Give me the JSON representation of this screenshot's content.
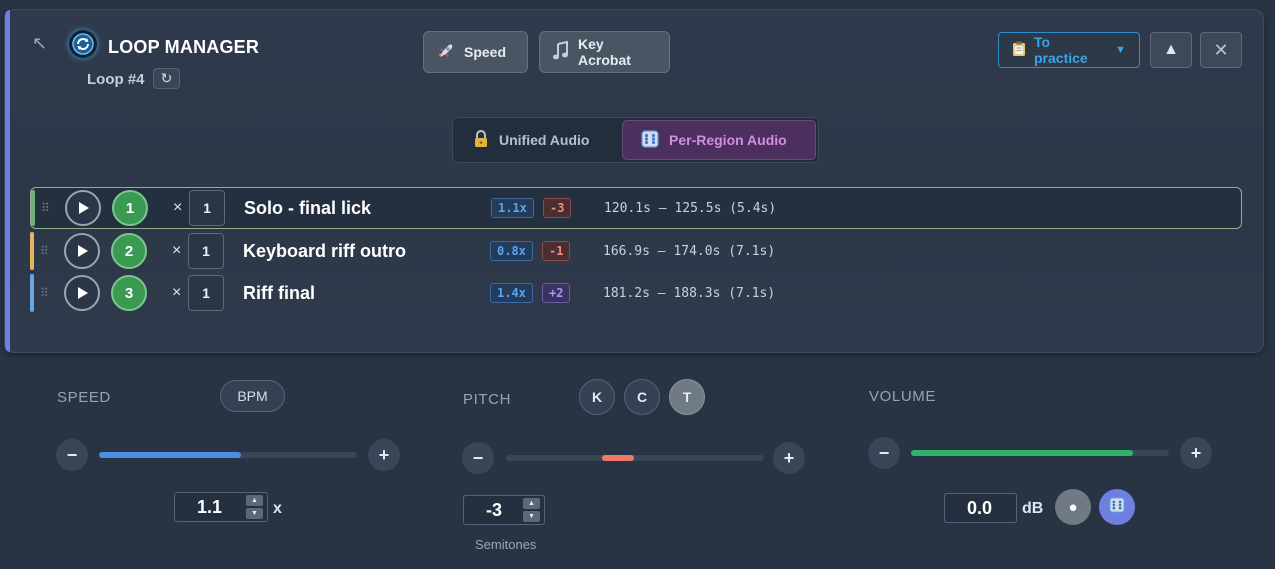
{
  "header": {
    "title": "LOOP MANAGER",
    "loop_number": "Loop #4",
    "refresh_symbol": "↻",
    "collapse_symbol": "↖",
    "speed_button": "Speed",
    "key_acrobat_button": "Key Acrobat",
    "practice_button": "To practice",
    "practice_caret": "▼",
    "up_symbol": "▲",
    "close_symbol": "✕"
  },
  "audio_mode": {
    "unified": "Unified Audio",
    "per_region": "Per-Region Audio",
    "selected": "per_region"
  },
  "loops": [
    {
      "index": "1",
      "times_symbol": "×",
      "repeat": "1",
      "name": "Solo - final lick",
      "speed": "1.1x",
      "pitch": "-3",
      "range": "120.1s – 125.5s (5.4s)",
      "stripe": "#6fb07a",
      "active": true
    },
    {
      "index": "2",
      "times_symbol": "×",
      "repeat": "1",
      "name": "Keyboard riff outro",
      "speed": "0.8x",
      "pitch": "-1",
      "range": "166.9s – 174.0s (7.1s)",
      "stripe": "#e8b25a",
      "active": false
    },
    {
      "index": "3",
      "times_symbol": "×",
      "repeat": "1",
      "name": "Riff final",
      "speed": "1.4x",
      "pitch": "+2",
      "range": "181.2s – 188.3s (7.1s)",
      "stripe": "#6aa6e0",
      "active": false
    }
  ],
  "speed": {
    "label": "SPEED",
    "bpm_button": "BPM",
    "value": "1.1",
    "unit": "x",
    "level": 0.55,
    "minus": "−",
    "plus": "+"
  },
  "pitch": {
    "label": "PITCH",
    "keys": [
      "K",
      "C",
      "T"
    ],
    "selected_key": "T",
    "value": "-3",
    "caption": "Semitones",
    "minus": "−",
    "plus": "+"
  },
  "volume": {
    "label": "VOLUME",
    "value": "0.0",
    "unit": "dB",
    "level": 0.86,
    "minus": "−",
    "plus": "+",
    "dot_symbol": "●"
  },
  "colors": {
    "accent": "#6d7fe0",
    "speed_fill": "#4a8fe0",
    "pitch_fill": "#f07a6a",
    "volume_fill": "#2fb36a",
    "per_region": "#d38ce8",
    "practice": "#3aa4e8"
  },
  "icons": {
    "logo": "loop-sync-icon",
    "speed": "rocket-icon",
    "key_acrobat": "music-note-icon",
    "practice": "clipboard-icon",
    "unified": "lock-icon",
    "per_region": "dice-icon"
  }
}
